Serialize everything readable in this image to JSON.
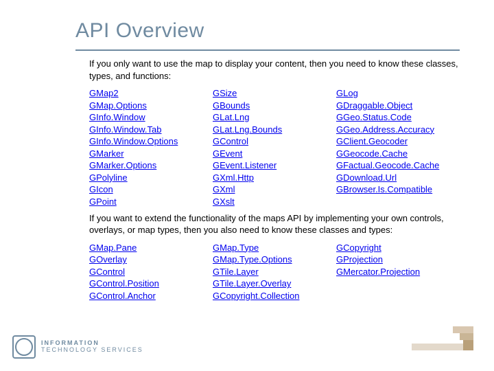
{
  "title": "API Overview",
  "intro1": "If you only want to use the map to display your content, then you need to know these classes, types, and functions:",
  "intro2": "If you want to extend the functionality of the maps API by implementing your own controls, overlays, or map types, then you also need to know these classes and types:",
  "group1": {
    "col1": [
      "GMap2",
      "GMap.Options",
      "GInfo.Window",
      "GInfo.Window.Tab",
      "GInfo.Window.Options",
      "GMarker",
      "GMarker.Options",
      "GPolyline",
      "GIcon",
      "GPoint"
    ],
    "col2": [
      "GSize",
      "GBounds",
      "GLat.Lng",
      "GLat.Lng.Bounds",
      "GControl",
      "GEvent",
      "GEvent.Listener",
      "GXml.Http",
      "GXml",
      "GXslt"
    ],
    "col3": [
      "GLog",
      "GDraggable.Object",
      "GGeo.Status.Code",
      "GGeo.Address.Accuracy",
      "GClient.Geocoder",
      "GGeocode.Cache",
      "GFactual.Geocode.Cache",
      "GDownload.Url",
      "GBrowser.Is.Compatible"
    ]
  },
  "group2": {
    "col1": [
      "GMap.Pane",
      "GOverlay",
      "GControl",
      "GControl.Position",
      "GControl.Anchor"
    ],
    "col2": [
      "GMap.Type",
      "GMap.Type.Options",
      "GTile.Layer",
      "GTile.Layer.Overlay",
      "GCopyright.Collection"
    ],
    "col3": [
      "GCopyright",
      "GProjection",
      "GMercator.Projection"
    ]
  },
  "footer": {
    "line1": "INFORMATION",
    "line2": "TECHNOLOGY SERVICES"
  }
}
